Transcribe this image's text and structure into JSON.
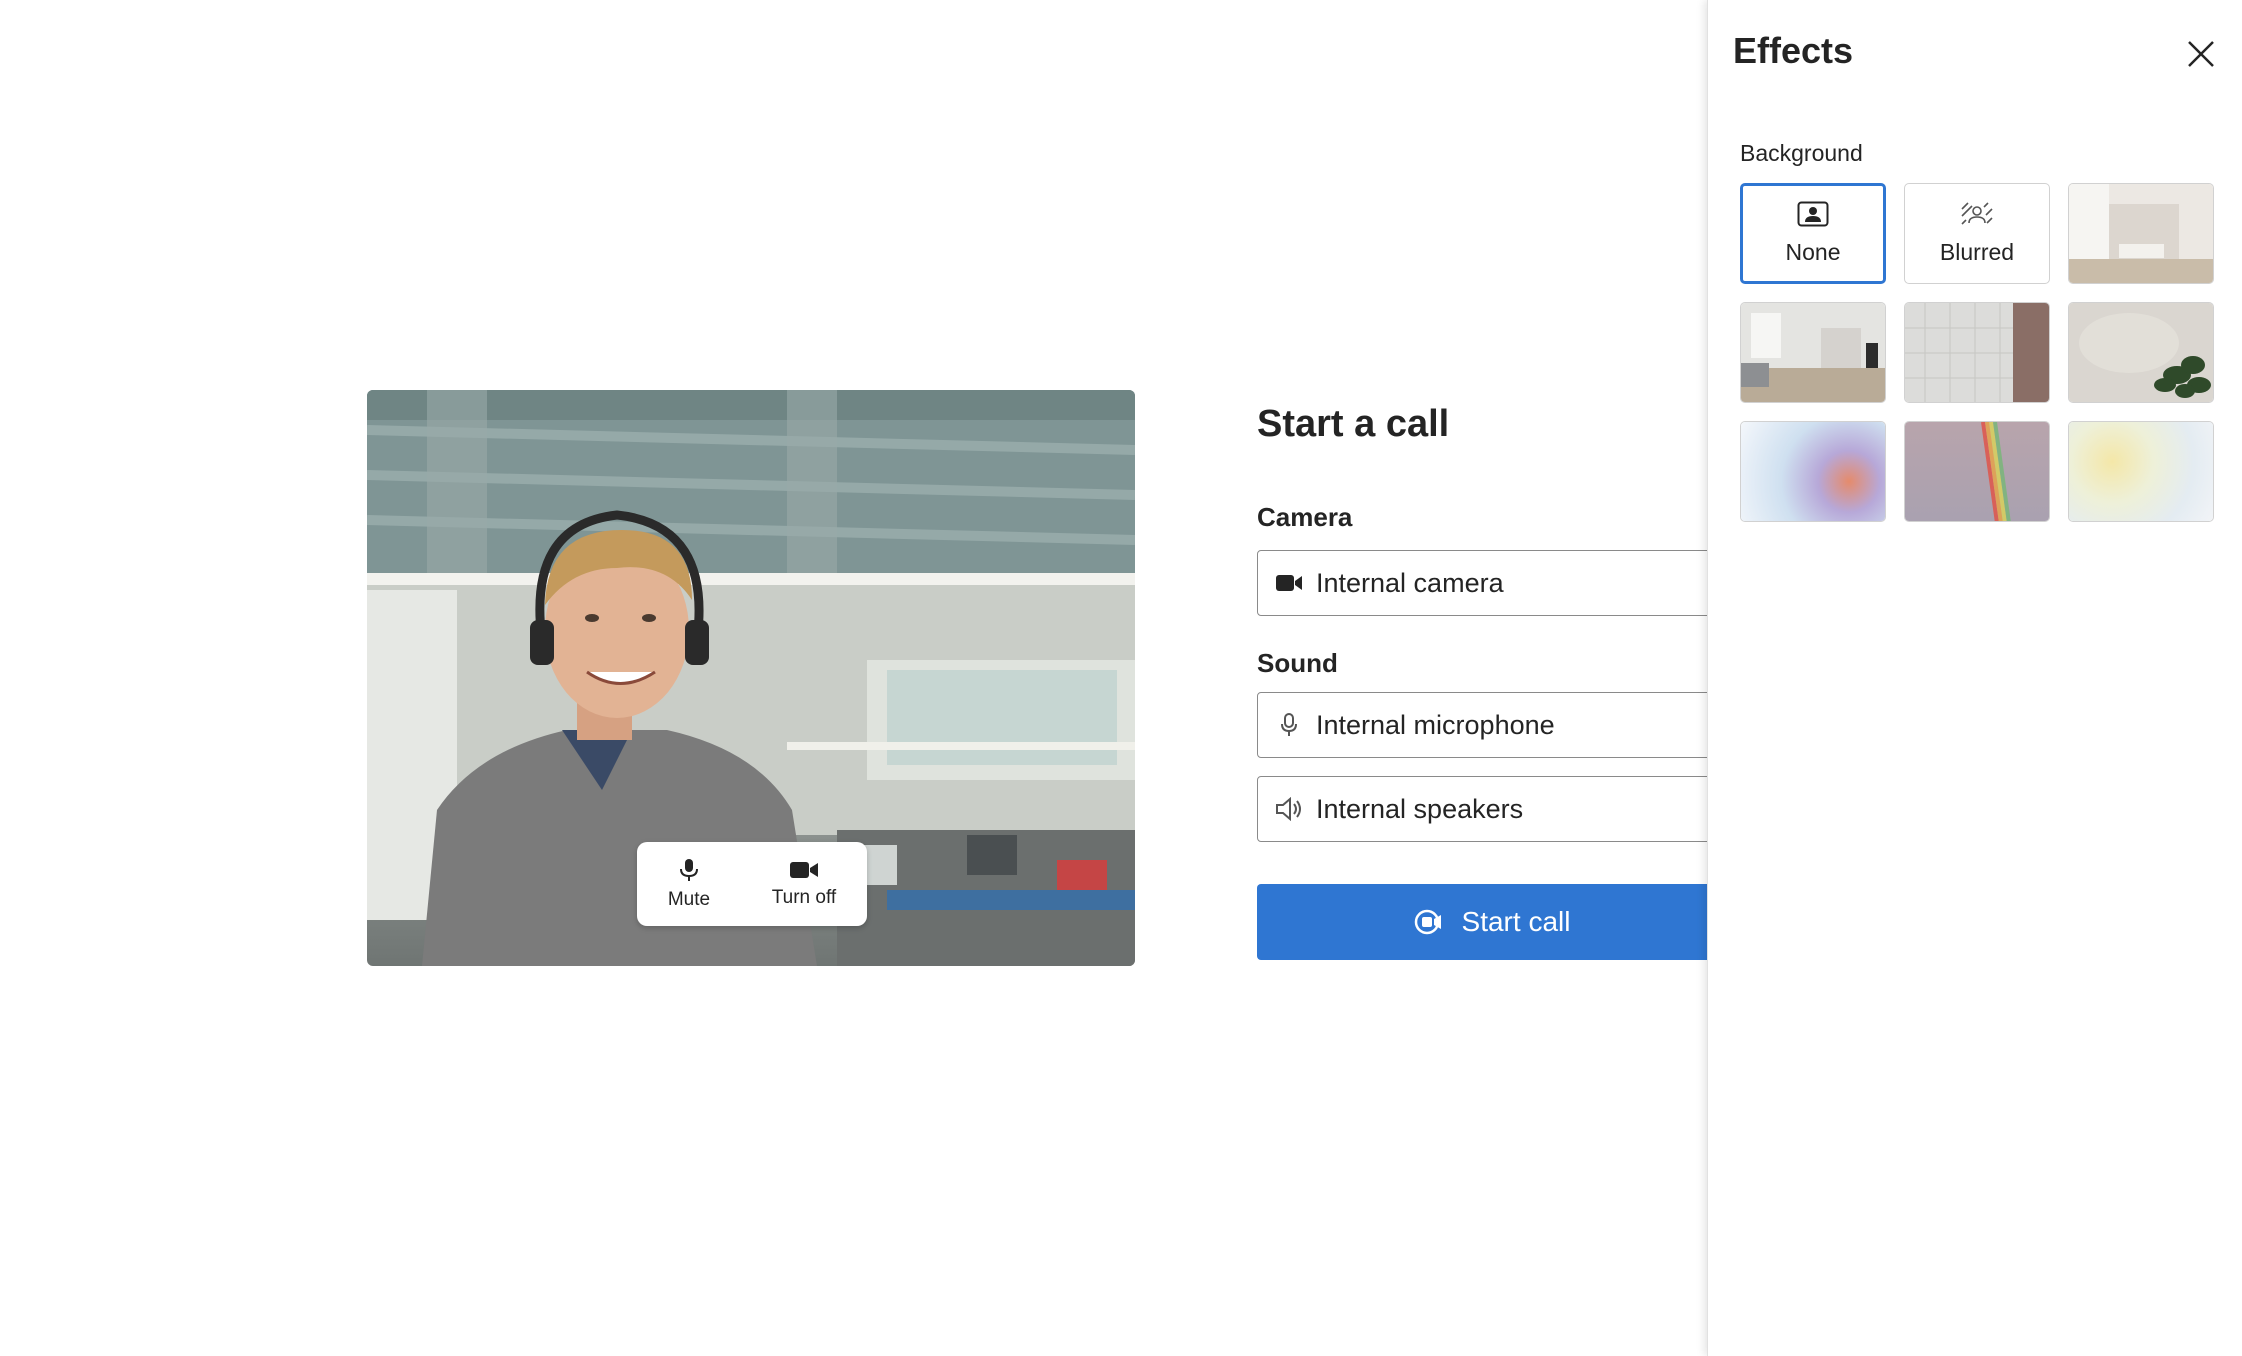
{
  "call": {
    "title": "Start a call",
    "camera_label": "Camera",
    "camera_device": "Internal camera",
    "sound_label": "Sound",
    "microphone_device": "Internal microphone",
    "speaker_device": "Internal speakers",
    "start_button": "Start call"
  },
  "preview": {
    "mute_label": "Mute",
    "camera_off_label": "Turn off"
  },
  "effects": {
    "title": "Effects",
    "background_label": "Background",
    "tiles": [
      {
        "label": "None",
        "icon": "person-frame-icon",
        "selected": true
      },
      {
        "label": "Blurred",
        "icon": "blur-icon",
        "selected": false
      },
      {
        "label": "",
        "image": "bright-bedroom",
        "selected": false
      },
      {
        "label": "",
        "image": "modern-living-room",
        "selected": false
      },
      {
        "label": "",
        "image": "tiled-wall",
        "selected": false
      },
      {
        "label": "",
        "image": "plant-wall",
        "selected": false
      },
      {
        "label": "",
        "image": "blue-orange-gradient",
        "selected": false
      },
      {
        "label": "",
        "image": "rainbow-sky",
        "selected": false
      },
      {
        "label": "",
        "image": "pastel-gradient",
        "selected": false
      }
    ]
  },
  "colors": {
    "accent": "#2f76d2",
    "text": "#242424",
    "border": "#8a8a8a"
  }
}
